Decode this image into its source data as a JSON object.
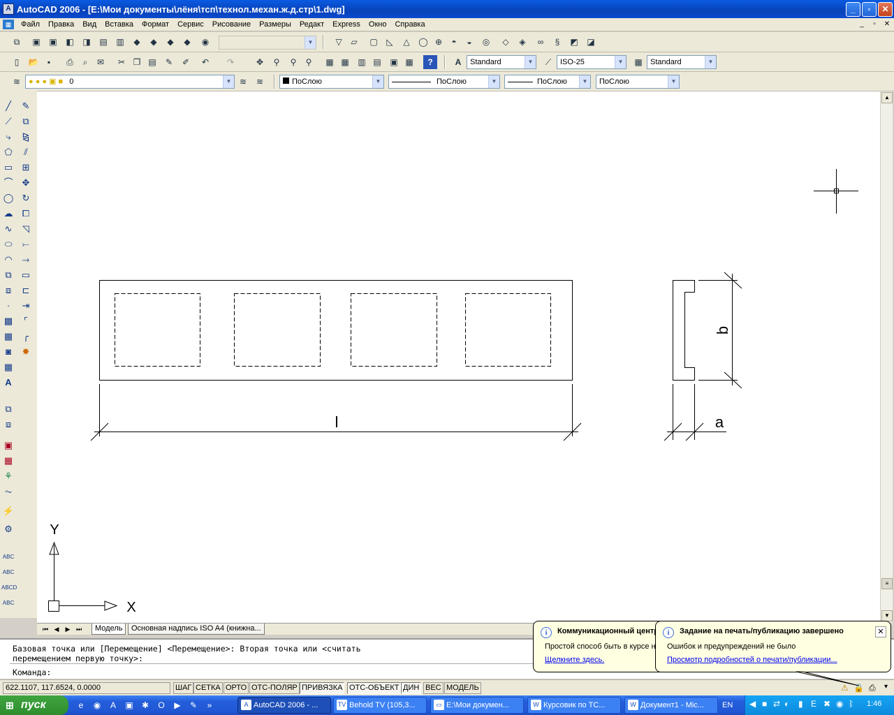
{
  "window": {
    "title": "AutoCAD 2006 - [E:\\Мои документы\\лёня\\тсп\\технол.механ.ж.д.стр\\1.dwg]",
    "min": "_",
    "max": "▫",
    "close": "✕"
  },
  "menu": [
    "Файл",
    "Правка",
    "Вид",
    "Вставка",
    "Формат",
    "Сервис",
    "Рисование",
    "Размеры",
    "Редакт",
    "Express",
    "Окно",
    "Справка"
  ],
  "mdi": {
    "min": "_",
    "restore": "▫",
    "close": "✕"
  },
  "toolbar": {
    "text_style": "Standard",
    "dim_style": "ISO-25",
    "table_style": "Standard",
    "layer": "0",
    "color": "ПоСлою",
    "linetype": "ПоСлою",
    "lineweight": "ПоСлою",
    "plotstyle": "ПоСлою"
  },
  "drawing": {
    "dim_length": "l",
    "dim_height": "b",
    "dim_width": "a",
    "ucs_x": "X",
    "ucs_y": "Y"
  },
  "tabs": [
    "Модель",
    "Основная надпись ISO A4 (книжна..."
  ],
  "command": {
    "line1": "Базовая точка или [Перемещение] <Перемещение>: Вторая точка или <считать",
    "line2": "перемещением первую точку>:",
    "prompt": "Команда:"
  },
  "status": {
    "coords": "622.1107, 117.6524, 0.0000",
    "toggles": [
      "ШАГ",
      "СЕТКА",
      "ОРТО",
      "ОТС-ПОЛЯР",
      "ПРИВЯЗКА",
      "ОТС-ОБЪЕКТ",
      "ДИН",
      "ВЕС",
      "МОДЕЛЬ"
    ]
  },
  "balloons": {
    "comm_title": "Коммуникационный центр",
    "comm_body": "Простой способ быть в курсе новостей",
    "comm_link": "Щелкните здесь.",
    "print_title": "Задание на печать/публикацию завершено",
    "print_body": "Ошибок и предупреждений не было",
    "print_link": "Просмотр подробностей о печати/публикации..."
  },
  "taskbar": {
    "start": "пуск",
    "tasks": [
      "AutoCAD 2006 - ...",
      "Behold TV (105,3...",
      "E:\\Мои докумен...",
      "Курсовик по ТС...",
      "Документ1 - Mic..."
    ],
    "lang": "EN",
    "time": "1:46"
  }
}
